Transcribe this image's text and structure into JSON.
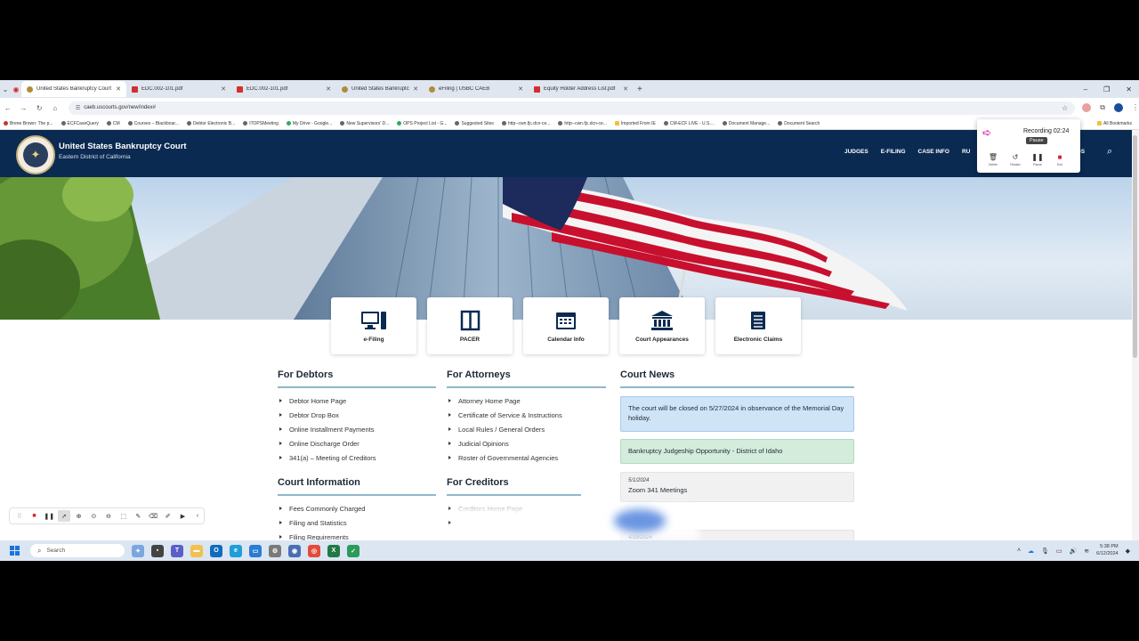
{
  "browser": {
    "tabs": [
      {
        "title": "United States Bankruptcy Court",
        "icon": "seal",
        "active": true
      },
      {
        "title": "EDC.002-101.pdf",
        "icon": "pdf"
      },
      {
        "title": "EDC.002-101.pdf",
        "icon": "pdf"
      },
      {
        "title": "United States Bankruptcy Court",
        "icon": "seal"
      },
      {
        "title": "eFiling | USBC CAEB",
        "icon": "seal"
      },
      {
        "title": "Equity Holder Address List.pdf",
        "icon": "pdf"
      }
    ],
    "new_tab": "+",
    "url": "caeb.uscourts.gov/new/index#",
    "bookmarks": [
      "Brene Brown: The p...",
      "ECFCaseQuery",
      "CM",
      "Courses – Blackboar...",
      "Debtor Electronic B...",
      "ITOPSMeeting",
      "My Drive - Google...",
      "New Supervisors' D...",
      "OPS Project List - G...",
      "Suggested Sites",
      "http--cwn.fjc.dcn-ce...",
      "http--cwn.fjc.dcn-ce...",
      "Imported From IE",
      "CM-ECF LIVE - U.S....",
      "Document Manage...",
      "Document Search"
    ],
    "all_bookmarks": "All Bookmarks"
  },
  "site": {
    "name": "United States Bankruptcy Court",
    "subtitle": "Eastern District of California",
    "nav": [
      "JUDGES",
      "E-FILING",
      "CASE INFO",
      "RU"
    ],
    "nav_tail": "DS"
  },
  "tiles": [
    {
      "label": "e-Filing",
      "icon": "computer-icon"
    },
    {
      "label": "PACER",
      "icon": "book-icon"
    },
    {
      "label": "Calendar Info",
      "icon": "calendar-icon"
    },
    {
      "label": "Court Appearances",
      "icon": "courthouse-icon"
    },
    {
      "label": "Electronic Claims",
      "icon": "document-stack-icon"
    }
  ],
  "debtors": {
    "title": "For Debtors",
    "links": [
      "Debtor Home Page",
      "Debtor Drop Box",
      "Online Installment Payments",
      "Online Discharge Order",
      "341(a) – Meeting of Creditors"
    ]
  },
  "attorneys": {
    "title": "For Attorneys",
    "links": [
      "Attorney Home Page",
      "Certificate of Service & Instructions",
      "Local Rules / General Orders",
      "Judicial Opinions",
      "Roster of Governmental Agencies"
    ]
  },
  "court_info": {
    "title": "Court Information",
    "links": [
      "Fees Commonly Charged",
      "Filing and Statistics",
      "Filing Requirements"
    ]
  },
  "creditors": {
    "title": "For Creditors",
    "links": [
      "Creditors Home Page",
      ""
    ]
  },
  "news": {
    "title": "Court News",
    "items": [
      {
        "text": "The court will be closed on 5/27/2024 in observance of the Memorial Day holiday.",
        "style": "blue"
      },
      {
        "text": "Bankruptcy Judgeship Opportunity - District of Idaho",
        "style": "green"
      },
      {
        "date": "5/1/2024",
        "text": "Zoom 341 Meetings",
        "style": "grey"
      }
    ],
    "cut_date": "4/18/2024"
  },
  "recorder": {
    "time": "Recording 02:24",
    "tooltip": "Pause",
    "buttons": [
      "Delete",
      "Restart",
      "Pause",
      "End"
    ]
  },
  "taskbar": {
    "search_placeholder": "Search",
    "time": "5:38 PM",
    "date": "6/12/2024"
  },
  "colors": {
    "header": "#0a2a52",
    "accent": "#1a4e9a",
    "rule": "#8fb8c9"
  }
}
